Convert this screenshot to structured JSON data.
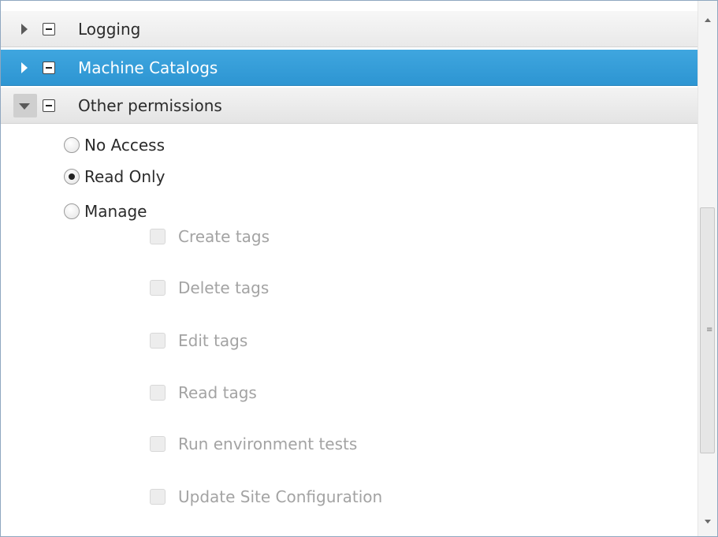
{
  "categories": [
    {
      "label": "Logging",
      "state": "collapsed"
    },
    {
      "label": "Machine Catalogs",
      "state": "collapsed-selected"
    },
    {
      "label": "Other permissions",
      "state": "expanded"
    }
  ],
  "access_options": [
    {
      "label": "No Access",
      "checked": false
    },
    {
      "label": "Read Only",
      "checked": true
    },
    {
      "label": "Manage",
      "checked": false
    }
  ],
  "manage_permissions": [
    {
      "label": "Create tags",
      "checked": false,
      "enabled": false
    },
    {
      "label": "Delete tags",
      "checked": false,
      "enabled": false
    },
    {
      "label": "Edit tags",
      "checked": false,
      "enabled": false
    },
    {
      "label": "Read tags",
      "checked": false,
      "enabled": false
    },
    {
      "label": "Run environment tests",
      "checked": false,
      "enabled": false
    },
    {
      "label": "Update Site Configuration",
      "checked": false,
      "enabled": false
    }
  ],
  "colors": {
    "selected_row": "#3a9fdb",
    "panel_border": "#8fa7c0",
    "disabled_text": "#a3a3a3"
  },
  "scrollbar": {
    "grip_glyph": "≡"
  }
}
